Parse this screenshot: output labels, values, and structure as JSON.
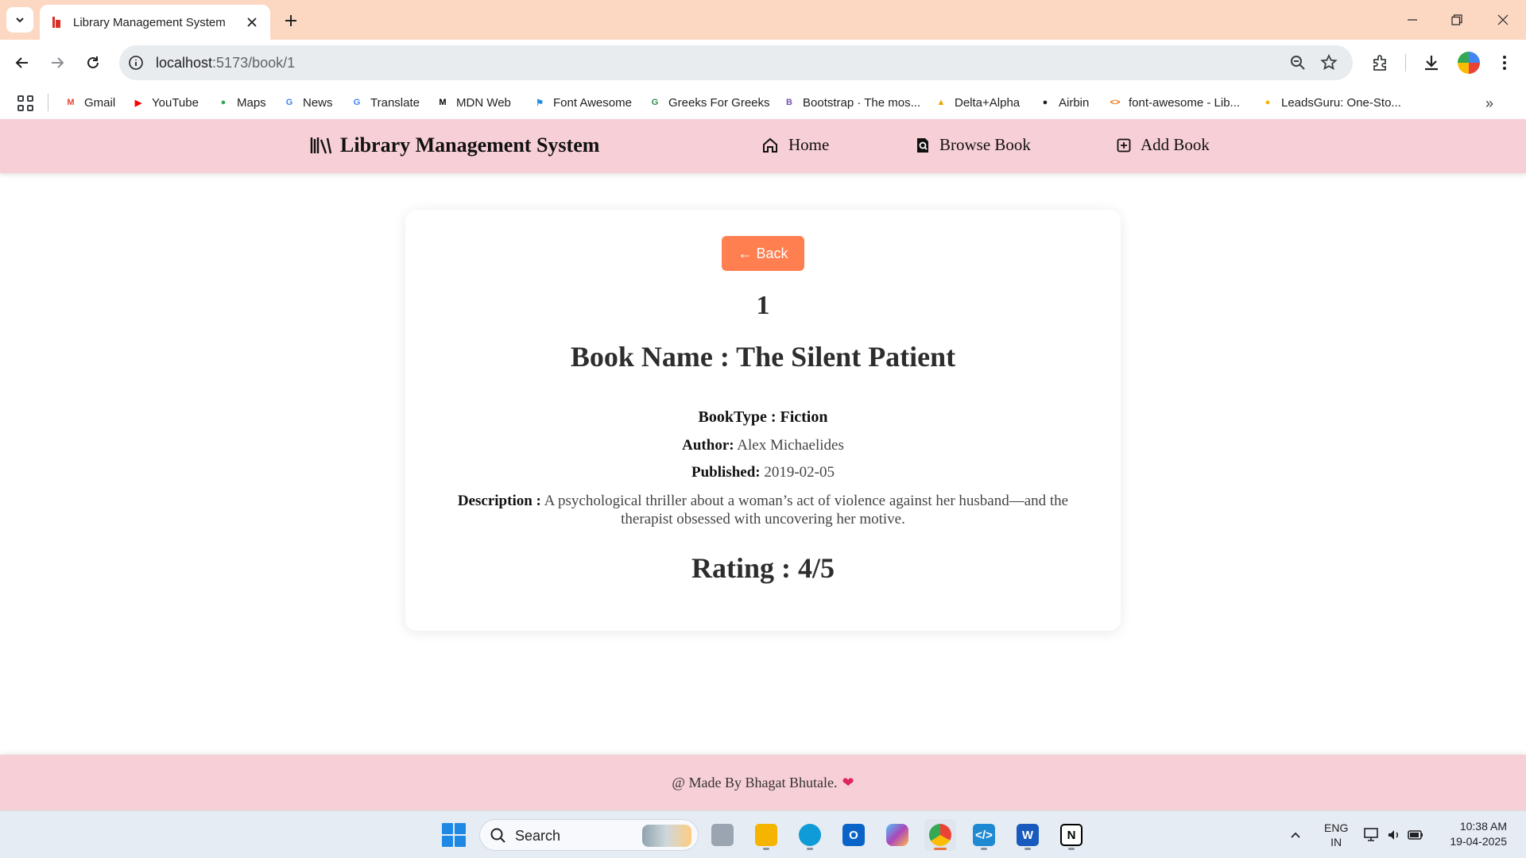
{
  "browser": {
    "tab_title": "Library Management System",
    "url_host": "localhost",
    "url_rest": ":5173/book/1"
  },
  "bookmarks": [
    {
      "label": "Gmail",
      "icon": "gmail-icon",
      "color": "#ea4335",
      "glyph": "M"
    },
    {
      "label": "YouTube",
      "icon": "youtube-icon",
      "color": "#ff0000",
      "glyph": "▶"
    },
    {
      "label": "Maps",
      "icon": "maps-icon",
      "color": "#34a853",
      "glyph": "●"
    },
    {
      "label": "News",
      "icon": "news-icon",
      "color": "#4285f4",
      "glyph": "G"
    },
    {
      "label": "Translate",
      "icon": "translate-icon",
      "color": "#4285f4",
      "glyph": "G"
    },
    {
      "label": "MDN Web",
      "icon": "mdn-icon",
      "color": "#000000",
      "glyph": "M"
    },
    {
      "label": "Font Awesome",
      "icon": "font-awesome-icon",
      "color": "#228be6",
      "glyph": "⚑"
    },
    {
      "label": "Greeks For Greeks",
      "icon": "gfg-icon",
      "color": "#2f8d46",
      "glyph": "G"
    },
    {
      "label": "Bootstrap · The mos...",
      "icon": "bootstrap-icon",
      "color": "#7952b3",
      "glyph": "B"
    },
    {
      "label": "Delta+Alpha",
      "icon": "delta-alpha-icon",
      "color": "#f0a500",
      "glyph": "▲"
    },
    {
      "label": "Airbin",
      "icon": "airbin-icon",
      "color": "#202124",
      "glyph": "●"
    },
    {
      "label": "font-awesome - Lib...",
      "icon": "code-icon",
      "color": "#e8710a",
      "glyph": "<>"
    },
    {
      "label": "LeadsGuru: One-Sto...",
      "icon": "leadsguru-icon",
      "color": "#f4b400",
      "glyph": "●"
    }
  ],
  "app": {
    "brand": "Library Management System",
    "nav": {
      "home": "Home",
      "browse": "Browse Book",
      "add": "Add Book"
    }
  },
  "book": {
    "back_label": "← Back",
    "id": "1",
    "name_line": "Book Name : The Silent Patient",
    "type_line": "BookType : Fiction",
    "author_label": "Author:",
    "author": "Alex Michaelides",
    "published_label": "Published:",
    "published": "2019-02-05",
    "description_label": "Description :",
    "description": "A psychological thriller about a woman’s act of violence against her husband—and the therapist obsessed with uncovering her motive.",
    "rating_line": "Rating : 4/5"
  },
  "footer": {
    "text": "@ Made By Bhagat Bhutale.",
    "heart": "❤"
  },
  "taskbar": {
    "search_label": "Search",
    "lang_top": "ENG",
    "lang_bottom": "IN",
    "time": "10:38 AM",
    "date": "19-04-2025"
  },
  "colors": {
    "accent": "#ff7f50",
    "nav_bg": "#f7cfd6",
    "tabbar_bg": "#fcd8c3"
  }
}
